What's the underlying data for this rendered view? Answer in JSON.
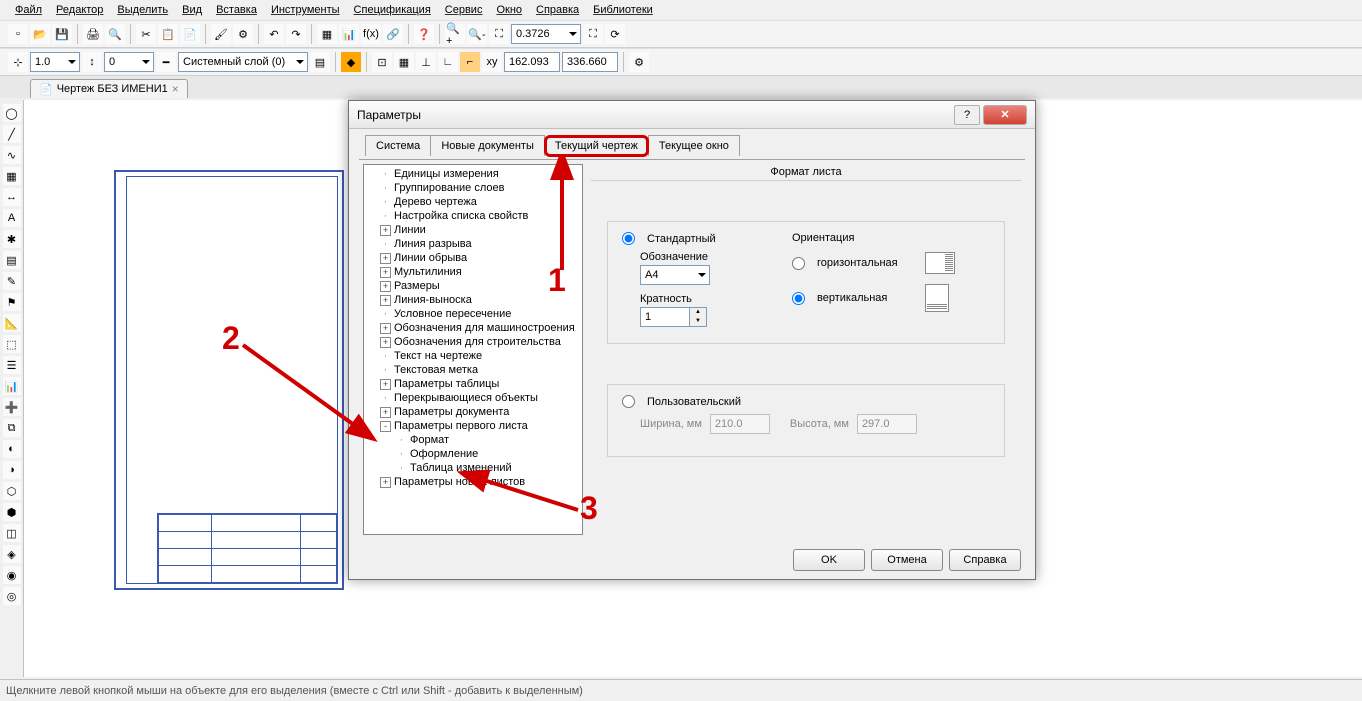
{
  "menubar": [
    "Файл",
    "Редактор",
    "Выделить",
    "Вид",
    "Вставка",
    "Инструменты",
    "Спецификация",
    "Сервис",
    "Окно",
    "Справка",
    "Библиотеки"
  ],
  "toolbar1": {
    "zoom_value": "0.3726"
  },
  "toolbar2": {
    "line_weight": "1.0",
    "style_value": "0",
    "layer_label": "Системный слой (0)",
    "coord_x": "162.093",
    "coord_y": "336.660"
  },
  "doc_tab": {
    "title": "Чертеж БЕЗ ИМЕНИ1"
  },
  "dialog": {
    "title": "Параметры",
    "tabs": [
      "Система",
      "Новые документы",
      "Текущий чертеж",
      "Текущее окно"
    ],
    "tree": [
      {
        "label": "Единицы измерения",
        "exp": null,
        "indent": 1
      },
      {
        "label": "Группирование слоев",
        "exp": null,
        "indent": 1
      },
      {
        "label": "Дерево чертежа",
        "exp": null,
        "indent": 1
      },
      {
        "label": "Настройка списка свойств",
        "exp": null,
        "indent": 1
      },
      {
        "label": "Линии",
        "exp": "+",
        "indent": 1
      },
      {
        "label": "Линия разрыва",
        "exp": null,
        "indent": 1
      },
      {
        "label": "Линии обрыва",
        "exp": "+",
        "indent": 1
      },
      {
        "label": "Мультилиния",
        "exp": "+",
        "indent": 1
      },
      {
        "label": "Размеры",
        "exp": "+",
        "indent": 1
      },
      {
        "label": "Линия-выноска",
        "exp": "+",
        "indent": 1
      },
      {
        "label": "Условное пересечение",
        "exp": null,
        "indent": 1
      },
      {
        "label": "Обозначения для машиностроения",
        "exp": "+",
        "indent": 1
      },
      {
        "label": "Обозначения для строительства",
        "exp": "+",
        "indent": 1
      },
      {
        "label": "Текст на чертеже",
        "exp": null,
        "indent": 1
      },
      {
        "label": "Текстовая метка",
        "exp": null,
        "indent": 1
      },
      {
        "label": "Параметры таблицы",
        "exp": "+",
        "indent": 1
      },
      {
        "label": "Перекрывающиеся объекты",
        "exp": null,
        "indent": 1
      },
      {
        "label": "Параметры документа",
        "exp": "+",
        "indent": 1
      },
      {
        "label": "Параметры первого листа",
        "exp": "-",
        "indent": 1
      },
      {
        "label": "Формат",
        "exp": null,
        "indent": 2
      },
      {
        "label": "Оформление",
        "exp": null,
        "indent": 2
      },
      {
        "label": "Таблица изменений",
        "exp": null,
        "indent": 2
      },
      {
        "label": "Параметры новых листов",
        "exp": "+",
        "indent": 1
      }
    ],
    "right": {
      "header": "Формат листа",
      "standard_label": "Стандартный",
      "designation_label": "Обозначение",
      "designation_value": "A4",
      "multiplicity_label": "Кратность",
      "multiplicity_value": "1",
      "orientation_label": "Ориентация",
      "horizontal_label": "горизонтальная",
      "vertical_label": "вертикальная",
      "custom_label": "Пользовательский",
      "width_label": "Ширина, мм",
      "width_value": "210.0",
      "height_label": "Высота, мм",
      "height_value": "297.0"
    },
    "buttons": {
      "ok": "OK",
      "cancel": "Отмена",
      "help": "Справка"
    }
  },
  "annotations": {
    "n1": "1",
    "n2": "2",
    "n3": "3"
  },
  "status": "Щелкните левой кнопкой мыши на объекте для его выделения (вместе с Ctrl или Shift - добавить к выделенным)"
}
